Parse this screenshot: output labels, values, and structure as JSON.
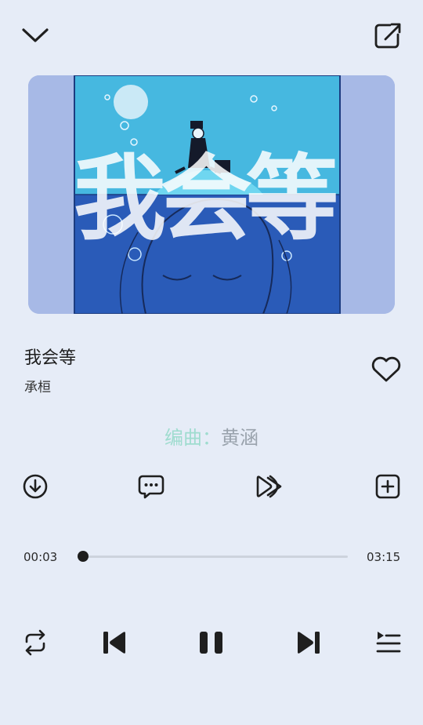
{
  "song": {
    "title": "我会等",
    "artist": "承桓"
  },
  "lyric": {
    "key": "编曲：",
    "value": "黄涵"
  },
  "progress": {
    "current": "00:03",
    "total": "03:15",
    "fraction": 0.015
  },
  "cover_art": {
    "title_text": "我会等"
  },
  "icons": {
    "collapse": "chevron-down-icon",
    "share": "share-icon",
    "like": "heart-icon",
    "download": "download-icon",
    "comments": "comment-icon",
    "effects": "fast-forward-icon",
    "add": "add-to-playlist-icon",
    "loop": "repeat-icon",
    "prev": "previous-icon",
    "pause": "pause-icon",
    "next": "next-icon",
    "queue": "queue-icon"
  },
  "colors": {
    "background": "#e6ecf7",
    "lyric_key": "#9fdccf",
    "lyric_value": "#9aa3ad",
    "cover_sky": "#46b8e0",
    "cover_sea": "#2a5bb8"
  }
}
